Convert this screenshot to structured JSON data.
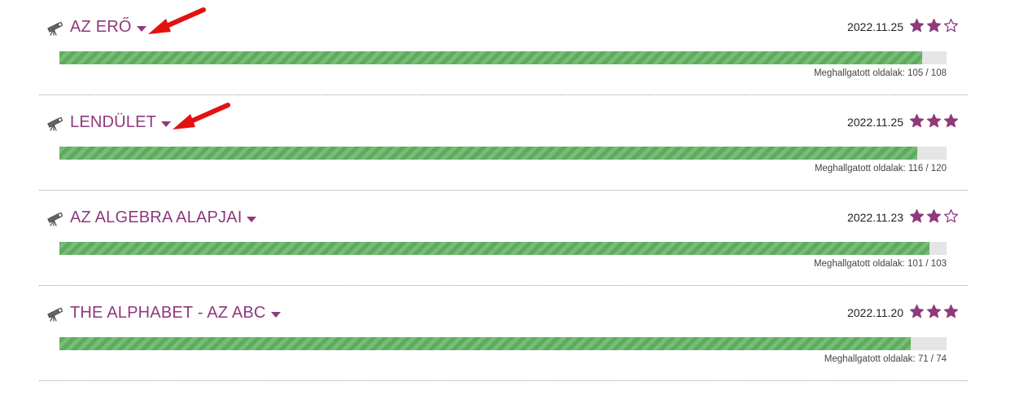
{
  "colors": {
    "accent": "#8e3a7c",
    "progress": "#5cac5c",
    "progress_track": "#e5e5e5",
    "annotation_arrow": "#e31111"
  },
  "entries": [
    {
      "title": "AZ ERŐ",
      "date": "2022.11.25",
      "rating": 2,
      "max_rating": 3,
      "pages_label": "Meghallgatott oldalak: 105 / 108",
      "pages_heard": 105,
      "pages_total": 108,
      "icon": "telescope-icon"
    },
    {
      "title": "LENDÜLET",
      "date": "2022.11.25",
      "rating": 3,
      "max_rating": 3,
      "pages_label": "Meghallgatott oldalak: 116 / 120",
      "pages_heard": 116,
      "pages_total": 120,
      "icon": "telescope-icon"
    },
    {
      "title": "AZ ALGEBRA ALAPJAI",
      "date": "2022.11.23",
      "rating": 2,
      "max_rating": 3,
      "pages_label": "Meghallgatott oldalak: 101 / 103",
      "pages_heard": 101,
      "pages_total": 103,
      "icon": "telescope-icon"
    },
    {
      "title": "THE ALPHABET - AZ ABC",
      "date": "2022.11.20",
      "rating": 3,
      "max_rating": 3,
      "pages_label": "Meghallgatott oldalak: 71 / 74",
      "pages_heard": 71,
      "pages_total": 74,
      "icon": "telescope-icon"
    }
  ]
}
